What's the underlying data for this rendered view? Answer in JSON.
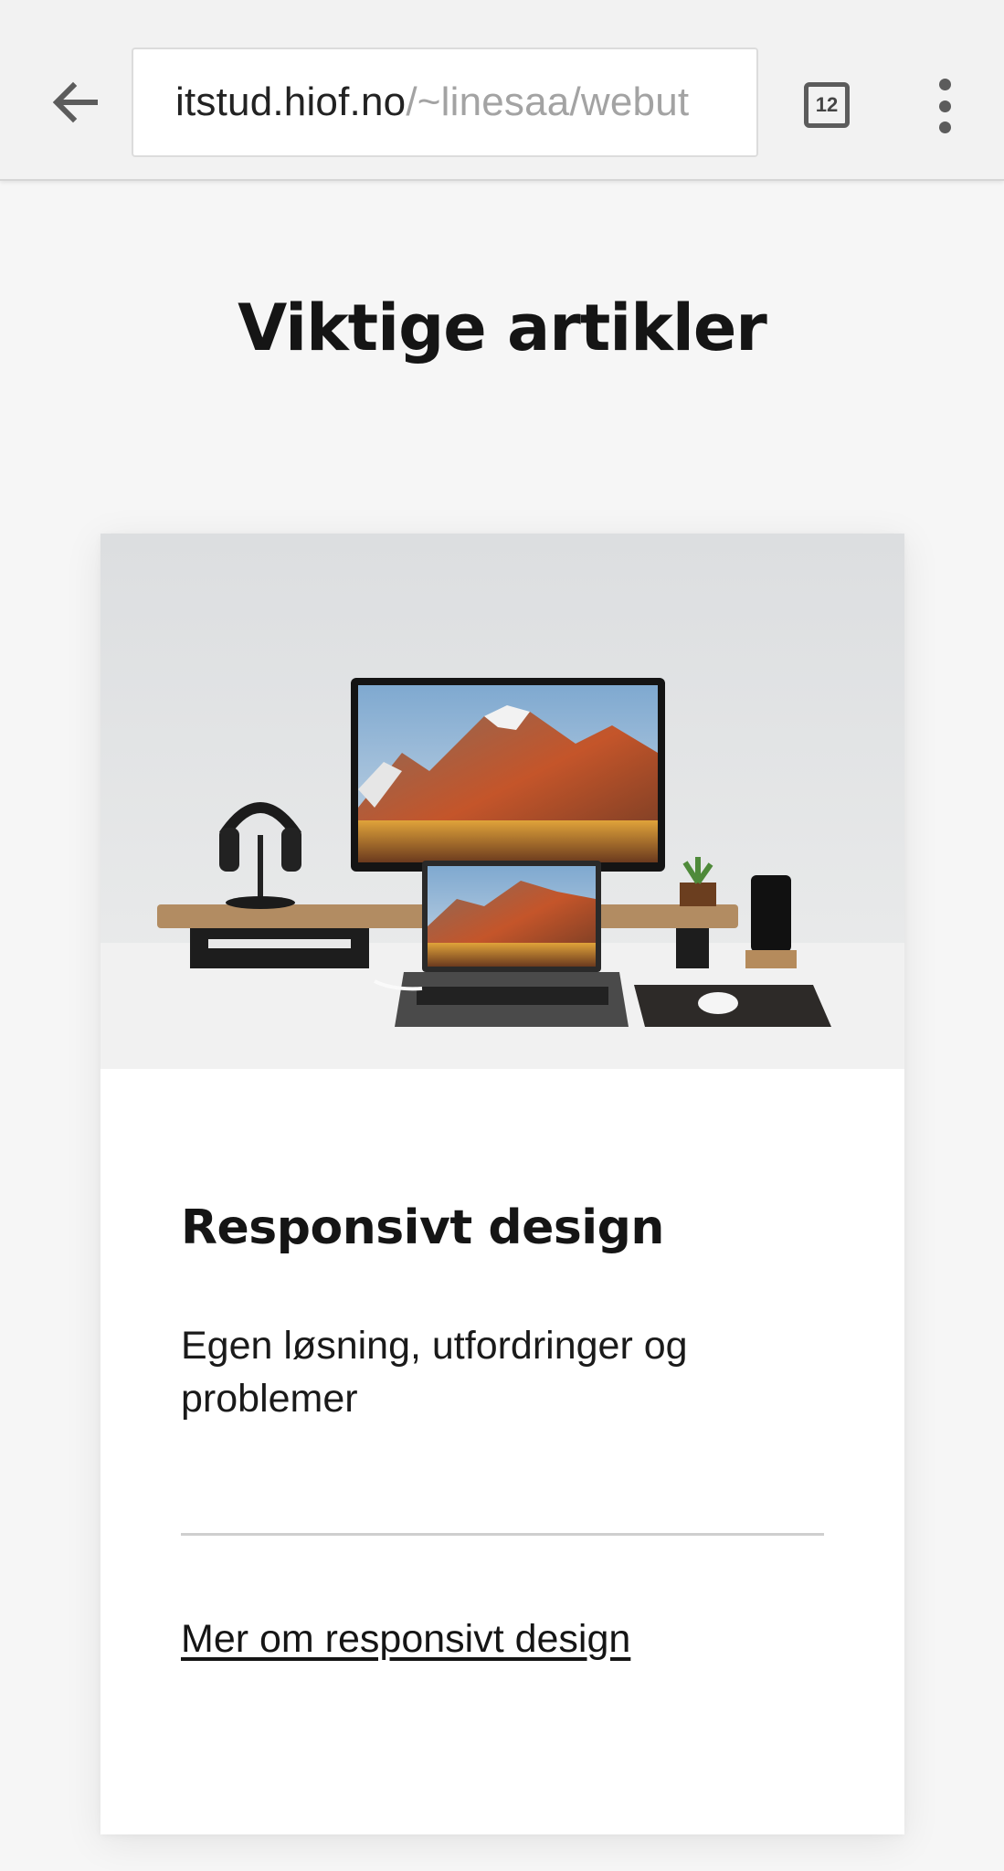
{
  "browser": {
    "url_host": "itstud.hiof.no",
    "url_path": "/~linesaa/webut",
    "tab_count": "12",
    "icons": {
      "back": "arrow-left-icon",
      "tabs": "tab-switcher-icon",
      "menu": "more-vert-icon"
    }
  },
  "page": {
    "title": "Viktige artikler"
  },
  "card": {
    "image_alt": "desk-setup-photo",
    "title": "Responsivt design",
    "description": "Egen løsning, utfordringer og problemer",
    "link_text": "Mer om responsivt design"
  },
  "colors": {
    "page_bg": "#f6f6f6",
    "toolbar_bg": "#f2f2f2",
    "text": "#151515"
  }
}
